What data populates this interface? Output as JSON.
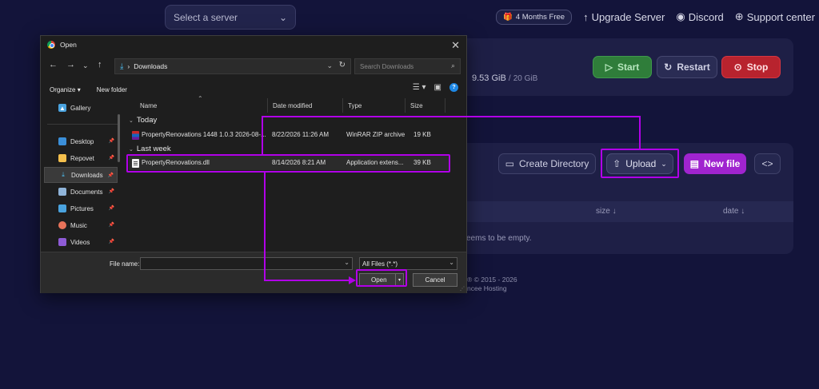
{
  "app": {
    "server_select_placeholder": "Select a server",
    "nav": {
      "free_badge": "4 Months Free",
      "upgrade": "Upgrade Server",
      "discord": "Discord",
      "support": "Support center"
    },
    "usage": {
      "used": "9.53 GiB",
      "separator": "/",
      "total": "20 GiB"
    },
    "power": {
      "start": "Start",
      "restart": "Restart",
      "stop": "Stop"
    },
    "files": {
      "create_directory": "Create Directory",
      "upload": "Upload",
      "new_file": "New file",
      "code_toggle": "<>",
      "col_size": "size",
      "col_date": "date",
      "empty_message": "seems to be empty."
    },
    "footer": {
      "line1": "® © 2015 - 2026",
      "line2": "ncee Hosting"
    },
    "colors": {
      "accent": "#b100e8",
      "start": "#2f7d3a",
      "stop": "#b8232e",
      "new_file": "#a024cf"
    }
  },
  "dialog": {
    "title": "Open",
    "address": "Downloads",
    "search_placeholder": "Search Downloads",
    "toolbar": {
      "organize": "Organize",
      "new_folder": "New folder"
    },
    "sidebar": [
      {
        "label": "Gallery",
        "icon": "gallery-icon",
        "pinned": false
      },
      {
        "label": "Desktop",
        "icon": "desktop-icon",
        "pinned": true
      },
      {
        "label": "Repovet",
        "icon": "folder-icon",
        "pinned": true
      },
      {
        "label": "Downloads",
        "icon": "download-icon",
        "pinned": true,
        "active": true
      },
      {
        "label": "Documents",
        "icon": "documents-icon",
        "pinned": true
      },
      {
        "label": "Pictures",
        "icon": "pictures-icon",
        "pinned": true
      },
      {
        "label": "Music",
        "icon": "music-icon",
        "pinned": true
      },
      {
        "label": "Videos",
        "icon": "videos-icon",
        "pinned": true
      }
    ],
    "columns": {
      "name": "Name",
      "date_modified": "Date modified",
      "type": "Type",
      "size": "Size"
    },
    "groups": [
      {
        "label": "Today",
        "files": [
          {
            "name": "PropertyRenovations 1448 1.0.3 2026-08-...",
            "date": "8/22/2026 11:26 AM",
            "type": "WinRAR ZIP archive",
            "size": "19 KB",
            "icon": "rar-archive-icon"
          }
        ]
      },
      {
        "label": "Last week",
        "files": [
          {
            "name": "PropertyRenovations.dll",
            "date": "8/14/2026 8:21 AM",
            "type": "Application extens...",
            "size": "39 KB",
            "icon": "dll-file-icon",
            "selected": true
          }
        ]
      }
    ],
    "file_name_label": "File name:",
    "file_name_value": "",
    "file_type": "All Files (*.*)",
    "open_button": "Open",
    "cancel_button": "Cancel"
  }
}
